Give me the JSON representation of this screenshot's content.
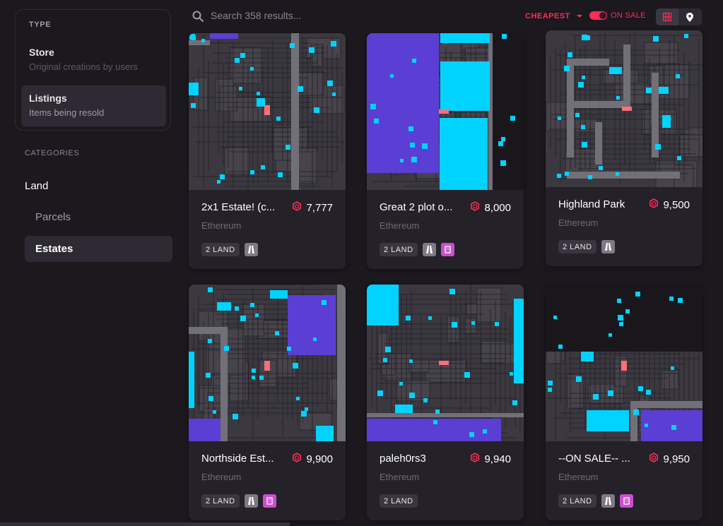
{
  "sidebar": {
    "type_title": "TYPE",
    "store": {
      "label": "Store",
      "sub": "Original creations by users"
    },
    "listings": {
      "label": "Listings",
      "sub": "Items being resold"
    },
    "categories_title": "CATEGORIES",
    "land": "Land",
    "parcels": "Parcels",
    "estates": "Estates"
  },
  "topbar": {
    "search_placeholder": "Search 358 results...",
    "sort": "CHEAPEST",
    "on_sale": "ON SALE",
    "view_active": "grid"
  },
  "colors": {
    "accent": "#ff2d55",
    "parcel": "#3b3840",
    "road": "#717078",
    "plaza": "#5b3ed3",
    "owned": "#00d3ff",
    "selected": "#ff6f77"
  },
  "cards": [
    {
      "name": "2x1 Estate! (c...",
      "price": "7,777",
      "network": "Ethereum",
      "tag": "2 LAND",
      "icons": [
        "road-icon"
      ]
    },
    {
      "name": "Great 2 plot o...",
      "price": "8,000",
      "network": "Ethereum",
      "tag": "2 LAND",
      "icons": [
        "road-icon",
        "plaza-icon"
      ]
    },
    {
      "name": "Highland Park",
      "price": "9,500",
      "network": "Ethereum",
      "tag": "2 LAND",
      "icons": [
        "road-icon"
      ]
    },
    {
      "name": "Northside Est...",
      "price": "9,900",
      "network": "Ethereum",
      "tag": "2 LAND",
      "icons": [
        "road-icon",
        "plaza-icon"
      ]
    },
    {
      "name": "paleh0rs3",
      "price": "9,940",
      "network": "Ethereum",
      "tag": "2 LAND",
      "icons": []
    },
    {
      "name": "--ON SALE-- ...",
      "price": "9,950",
      "network": "Ethereum",
      "tag": "2 LAND",
      "icons": [
        "road-icon",
        "plaza-icon"
      ]
    }
  ]
}
